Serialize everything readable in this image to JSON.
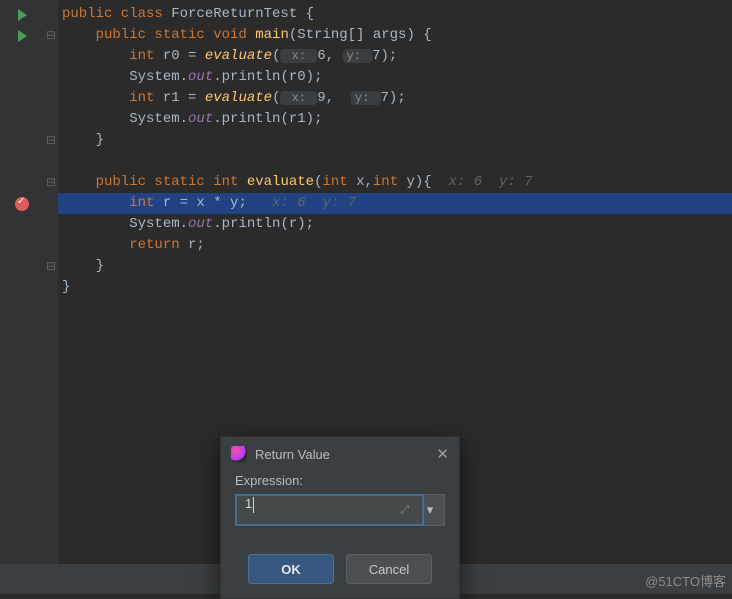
{
  "code": {
    "l1": {
      "kw": "public class ",
      "cls": "ForceReturnTest ",
      "brace": "{"
    },
    "l2": {
      "kw": "    public static void ",
      "mth": "main",
      "args": "(String[] args) {"
    },
    "l3": {
      "pre": "        ",
      "kw": "int ",
      "var": "r0 = ",
      "call": "evaluate",
      "open": "(",
      "h1": " x: ",
      "v1": "6",
      "c": ", ",
      "h2": "y: ",
      "v2": "7",
      "close": ");"
    },
    "l4": {
      "pre": "        System.",
      "field": "out",
      "rest": ".println(r0);"
    },
    "l5": {
      "pre": "        ",
      "kw": "int ",
      "var": "r1 = ",
      "call": "evaluate",
      "open": "(",
      "h1": " x: ",
      "v1": "9",
      "c": ",  ",
      "h2": "y: ",
      "v2": "7",
      "close": ");"
    },
    "l6": {
      "pre": "        System.",
      "field": "out",
      "rest": ".println(r1);"
    },
    "l7": {
      "pre": "    }"
    },
    "l8": {
      "pre": ""
    },
    "l9": {
      "kw": "    public static int ",
      "mth": "evaluate",
      "args": "(",
      "kw2": "int ",
      "p1": "x,",
      "kw3": "int ",
      "p2": "y){",
      "ann": "  x: 6  y: 7"
    },
    "l10": {
      "pre": "        ",
      "kw": "int ",
      "rest": "r = x * y;",
      "ann": "   x: 6  y: 7"
    },
    "l11": {
      "pre": "        System.",
      "field": "out",
      "rest": ".println(r);"
    },
    "l12": {
      "pre": "        ",
      "kw": "return ",
      "rest": "r;"
    },
    "l13": {
      "pre": "    }"
    },
    "l14": {
      "pre": "}"
    }
  },
  "dialog": {
    "title": "Return Value",
    "expression_label": "Expression:",
    "expression_value": "1",
    "ok": "OK",
    "cancel": "Cancel"
  },
  "watermark": "@51CTO博客"
}
